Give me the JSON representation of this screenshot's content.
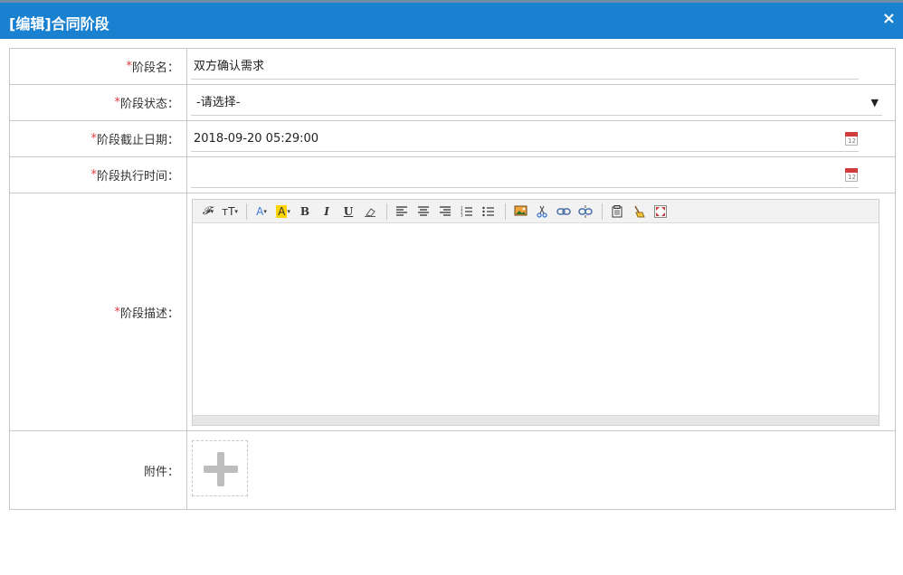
{
  "dialog": {
    "title": "[编辑]合同阶段",
    "close": "×"
  },
  "fields": {
    "name": {
      "req": "*",
      "label": "阶段名：",
      "value": "双方确认需求"
    },
    "status": {
      "req": "*",
      "label": "阶段状态：",
      "value": "-请选择-",
      "arrow": "▼"
    },
    "deadline": {
      "req": "*",
      "label": "阶段截止日期：",
      "value": "2018-09-20 05:29:00"
    },
    "exec_time": {
      "req": "*",
      "label": "阶段执行时间：",
      "value": ""
    },
    "description": {
      "req": "*",
      "label": "阶段描述：",
      "value": ""
    },
    "attachment": {
      "label": "附件："
    }
  },
  "calendar_icon_text": "12",
  "toolbar": {
    "font_family": "𝓕",
    "font_size": "ᴛT",
    "font_color": "A",
    "highlight": "A",
    "bold": "B",
    "italic": "I",
    "underline": "U"
  },
  "colors": {
    "title_bar": "#1a81d0",
    "required_mark": "#e53b3b",
    "border": "#c8c8c8"
  }
}
